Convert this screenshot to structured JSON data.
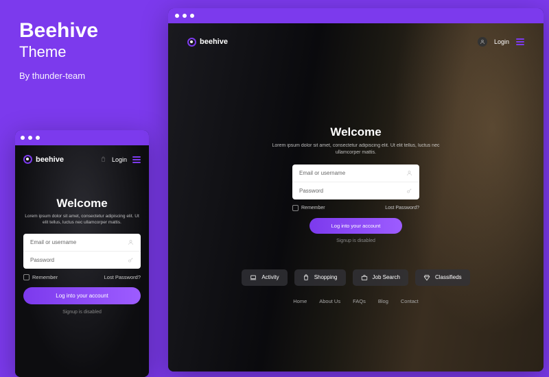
{
  "promo": {
    "title": "Beehive",
    "subtitle": "Theme",
    "byline": "By thunder-team"
  },
  "brand": "beehive",
  "header": {
    "login_label": "Login"
  },
  "welcome": {
    "heading": "Welcome",
    "subtext": "Lorem ipsum dolor sit amet, consectetur adipiscing elit. Ut elit tellus, luctus nec ullamcorper mattis."
  },
  "form": {
    "email_placeholder": "Email or username",
    "password_placeholder": "Password",
    "remember_label": "Remember",
    "lost_password_label": "Lost Password?",
    "submit_label": "Log into your account",
    "disabled_text": "Signup is disabled"
  },
  "pills": [
    {
      "icon": "laptop-icon",
      "label": "Activity"
    },
    {
      "icon": "bag-icon",
      "label": "Shopping"
    },
    {
      "icon": "briefcase-icon",
      "label": "Job Search"
    },
    {
      "icon": "diamond-icon",
      "label": "Classifieds"
    }
  ],
  "footer": [
    "Home",
    "About Us",
    "FAQs",
    "Blog",
    "Contact"
  ],
  "colors": {
    "accent": "#7c3aed"
  }
}
